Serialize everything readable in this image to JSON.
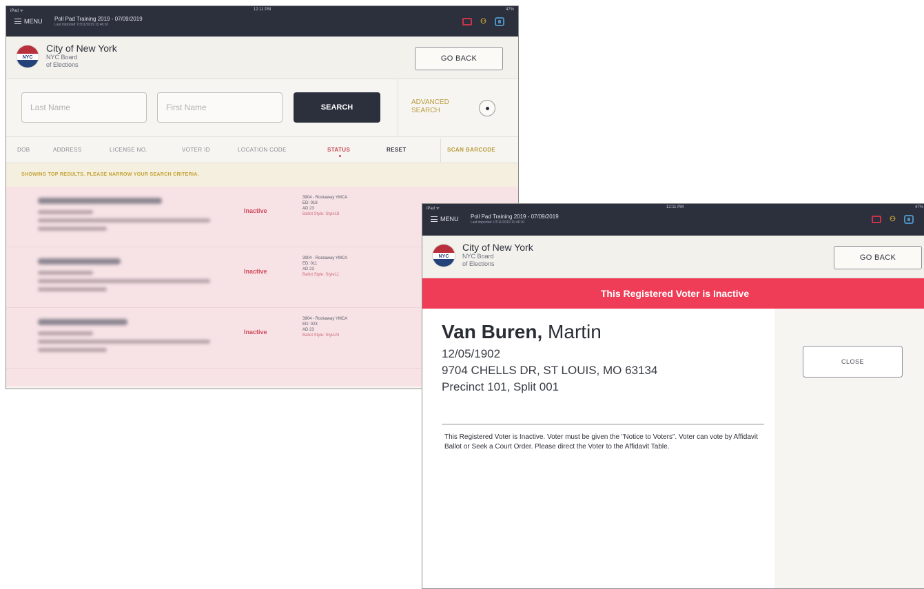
{
  "screen_a": {
    "status": {
      "carrier": "iPad ᯤ",
      "time": "12:11 PM",
      "battery": "47%"
    },
    "menu_label": "MENU",
    "training_title": "Poll Pad Training 2019 - 07/09/2019",
    "training_sub": "Last imported: 07/11/2019 11:46:10",
    "org_title": "City of New York",
    "org_sub1": "NYC Board",
    "org_sub2": "of Elections",
    "go_back": "GO BACK",
    "search": {
      "last_name_placeholder": "Last Name",
      "first_name_placeholder": "First Name",
      "button": "SEARCH",
      "advanced_line1": "ADVANCED",
      "advanced_line2": "SEARCH"
    },
    "filters": [
      "DOB",
      "ADDRESS",
      "LICENSE NO.",
      "VOTER ID",
      "LOCATION CODE",
      "STATUS",
      "RESET",
      "SCAN BARCODE"
    ],
    "notice": "SHOWING TOP RESULTS. PLEASE NARROW YOUR SEARCH CRITERIA.",
    "results": [
      {
        "status": "Inactive",
        "location": "3904 - Rockaway YMCA",
        "ed": "ED: 018",
        "ad": "AD 23",
        "ballot": "Ballot Style: Style18"
      },
      {
        "status": "Inactive",
        "location": "3904 - Rockaway YMCA",
        "ed": "ED: 011",
        "ad": "AD 23",
        "ballot": "Ballot Style: Style11"
      },
      {
        "status": "Inactive",
        "location": "3904 - Rockaway YMCA",
        "ed": "ED: 023",
        "ad": "AD 23",
        "ballot": "Ballot Style: Style23"
      }
    ]
  },
  "screen_b": {
    "status": {
      "carrier": "iPad ᯤ",
      "time": "12:11 PM",
      "battery": "47%"
    },
    "menu_label": "MENU",
    "training_title": "Poll Pad Training 2019 - 07/09/2019",
    "training_sub": "Last imported: 07/11/2019 11:46:10",
    "org_title": "City of New York",
    "org_sub1": "NYC Board",
    "org_sub2": "of Elections",
    "go_back": "GO BACK",
    "banner": "This Registered Voter is Inactive",
    "voter_last": "Van Buren,",
    "voter_first": " Martin",
    "dob": "12/05/1902",
    "address": "9704 CHELLS DR, ST LOUIS, MO 63134",
    "precinct": "Precinct 101, Split 001",
    "close": "CLOSE",
    "message": "This Registered Voter is Inactive.  Voter must be given the \"Notice to Voters\".  Voter can vote by Affidavit Ballot or Seek a Court Order. Please direct the Voter to the Affidavit Table."
  },
  "colors": {
    "navy": "#2c2f3c",
    "inactive_red": "#ef3d57",
    "gold": "#b99b3d",
    "result_pink": "#f7e3e6"
  },
  "icons": [
    "menu-icon",
    "printer-icon",
    "users-icon",
    "badge-icon",
    "radio-icon"
  ]
}
